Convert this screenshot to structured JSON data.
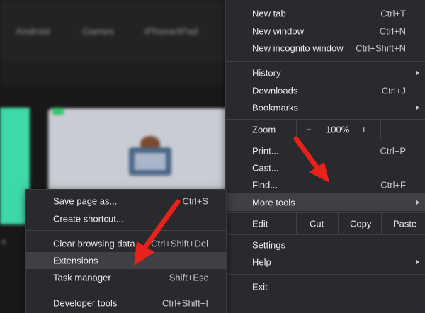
{
  "background": {
    "nav_items": [
      "Android",
      "Games",
      "iPhone/iPad"
    ],
    "side_text": "s"
  },
  "main_menu": {
    "new_tab": {
      "label": "New tab",
      "shortcut": "Ctrl+T"
    },
    "new_window": {
      "label": "New window",
      "shortcut": "Ctrl+N"
    },
    "new_incognito": {
      "label": "New incognito window",
      "shortcut": "Ctrl+Shift+N"
    },
    "history": {
      "label": "History"
    },
    "downloads": {
      "label": "Downloads",
      "shortcut": "Ctrl+J"
    },
    "bookmarks": {
      "label": "Bookmarks"
    },
    "zoom": {
      "label": "Zoom",
      "minus": "−",
      "value": "100%",
      "plus": "+"
    },
    "print": {
      "label": "Print...",
      "shortcut": "Ctrl+P"
    },
    "cast": {
      "label": "Cast..."
    },
    "find": {
      "label": "Find...",
      "shortcut": "Ctrl+F"
    },
    "more_tools": {
      "label": "More tools"
    },
    "edit": {
      "label": "Edit",
      "cut": "Cut",
      "copy": "Copy",
      "paste": "Paste"
    },
    "settings": {
      "label": "Settings"
    },
    "help": {
      "label": "Help"
    },
    "exit": {
      "label": "Exit"
    }
  },
  "sub_menu": {
    "save_page": {
      "label": "Save page as...",
      "shortcut": "Ctrl+S"
    },
    "create_shortcut": {
      "label": "Create shortcut..."
    },
    "clear_data": {
      "label": "Clear browsing data...",
      "shortcut": "Ctrl+Shift+Del"
    },
    "extensions": {
      "label": "Extensions"
    },
    "task_manager": {
      "label": "Task manager",
      "shortcut": "Shift+Esc"
    },
    "dev_tools": {
      "label": "Developer tools",
      "shortcut": "Ctrl+Shift+I"
    }
  },
  "colors": {
    "menu_bg": "#292a2d",
    "highlight": "#3f4043",
    "annotation_arrow": "#e8221b",
    "accent_teal": "#3ed9a8"
  }
}
